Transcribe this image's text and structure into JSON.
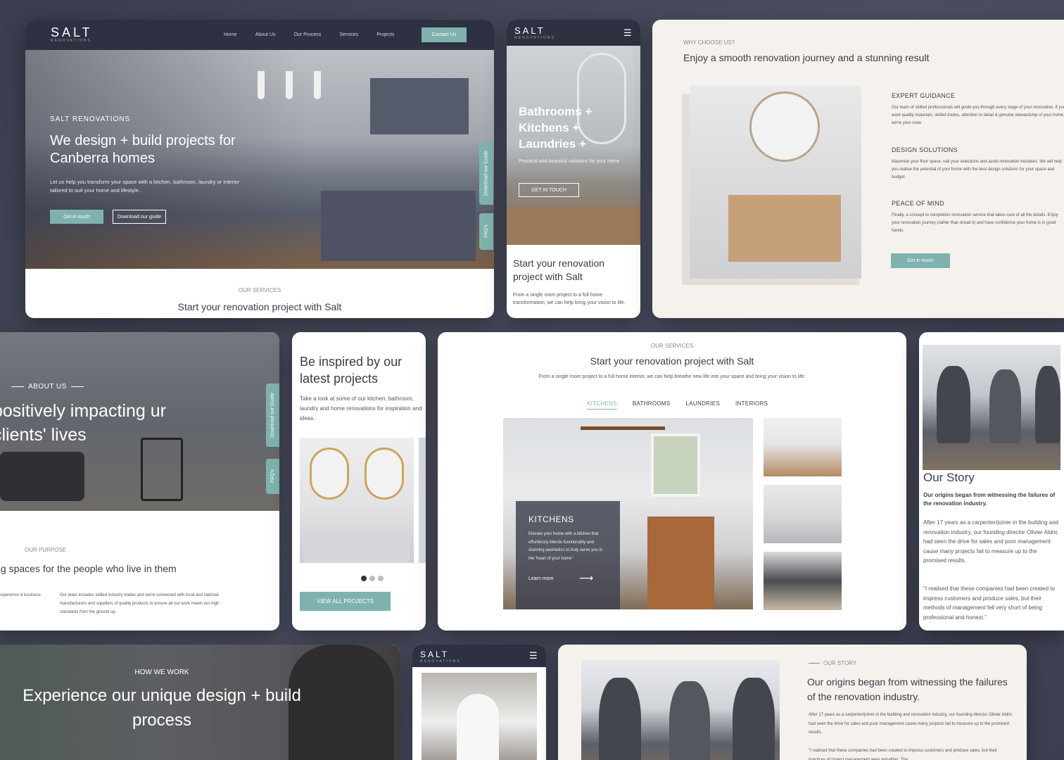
{
  "brand": {
    "logo": "SALT",
    "logo_sub": "RENOVATIONS",
    "accent": "#7fb2ae",
    "navy": "#2e3142"
  },
  "hero_desktop": {
    "nav": [
      "Home",
      "About Us",
      "Our Process",
      "Services",
      "Projects"
    ],
    "contact": "Contact Us",
    "label": "SALT RENOVATIONS",
    "title": "We design + build projects for Canberra homes",
    "text": "Let us help you transform your space with a kitchen, bathroom, laundry or interior tailored to suit your home and lifestyle.",
    "btn_primary": "Get in touch",
    "btn_secondary": "Download our guide",
    "tab_guide": "Download our Guide",
    "tab_faq": "FAQ's",
    "services_label": "OUR SERVICES",
    "services_title": "Start your renovation project with Salt"
  },
  "hero_mobile": {
    "menu_icon": "☰",
    "title": "Bathrooms + Kitchens + Laundries +",
    "text": "Practical and beautiful solutions for your home",
    "btn": "GET IN TOUCH",
    "section_title": "Start your renovation project with Salt",
    "section_text": "From a single room project to a full home transformation, we can help bring your vision to life."
  },
  "why": {
    "label": "WHY CHOOSE US?",
    "title": "Enjoy a smooth renovation journey and a stunning result",
    "features": [
      {
        "title": "EXPERT GUIDANCE",
        "text": "Our team of skilled professionals will guide you through every stage of your renovation. If you want quality materials, skilled trades, attention to detail & genuine stewardship of your home, we're your crew."
      },
      {
        "title": "DESIGN SOLUTIONS",
        "text": "Maximise your floor space, nail your selections and avoid renovation mistakes. We will help you realise the potential of your home with the best design solutions for your space and budget."
      },
      {
        "title": "PEACE OF MIND",
        "text": "Finally, a concept to completion renovation service that takes care of all the details. Enjoy your renovation journey (rather than dread it) and have confidence your home is in good hands."
      }
    ],
    "btn": "Get in touch"
  },
  "about": {
    "label": "ABOUT US",
    "title": "positively impacting ur clients' lives",
    "tab_guide": "Download our Guide",
    "tab_faq": "FAQ's",
    "purpose_label": "OUR PURPOSE",
    "purpose_title": "ing spaces for the people who live in them",
    "col1": "se experience d business",
    "col2": "Our team includes skilled industry trades and we're connected with local and national manufacturers and suppliers of quality products to ensure all our work meets our high standards from the ground up."
  },
  "inspired": {
    "title": "Be inspired by our latest projects",
    "text": "Take a look at some of our kitchen, bathroom, laundry and home renovations for inspiration and ideas.",
    "btn": "VIEW ALL PROJECTS"
  },
  "services": {
    "label": "OUR SERVICES",
    "title": "Start your renovation project with Salt",
    "sub": "From a single room project to a full home interior, we can help breathe new life into your space and bring your vision to life.",
    "tabs": [
      "KITCHENS",
      "BATHROOMS",
      "LAUNDRIES",
      "INTERIORS"
    ],
    "card_title": "KITCHENS",
    "card_text": "Elevate your home with a kitchen that effortlessly blends functionality and stunning aesthetics to truly serve you in the 'heart of your home'",
    "learn_more": "Learn more",
    "arrow": "⟶"
  },
  "story_mobile": {
    "title": "Our Story",
    "lead": "Our origins began from witnessing the failures of the renovation industry.",
    "p1": "After 17 years as a carpenter/joiner in the building and renovation industry, our founding director Olivier Aldric had seen the drive for sales and poor management cause many projects fail to measure up to the promised results.",
    "p2": "\"I realised that these companies had been created to impress customers and produce sales, but their methods of management fell very short of being professional and honest.\""
  },
  "how": {
    "label": "HOW WE WORK",
    "title": "Experience our unique design + build process"
  },
  "mobile3": {
    "menu_icon": "☰"
  },
  "story_desktop": {
    "label": "OUR STORY",
    "title": "Our origins began from witnessing the failures of the renovation industry.",
    "p1": "After 17 years as a carpenter/joiner in the building and renovation industry, our founding director Olivier Aldric had seen the drive for sales and poor management cause many projects fail to measure up to the promised results.",
    "p2": "\"I realised that these companies had been created to impress customers and produce sales, but their practices of project management were appalling. The"
  }
}
